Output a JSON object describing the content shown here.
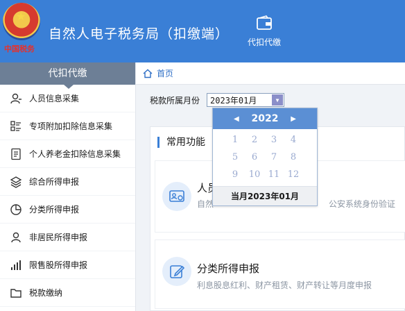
{
  "header": {
    "brand_seal": "中国税务",
    "title": "自然人电子税务局（扣缴端）",
    "nav_tab_label": "代扣代缴",
    "color": "#3a7fd6"
  },
  "sidebar": {
    "heading": "代扣代缴",
    "items": [
      {
        "label": "人员信息采集",
        "icon": "person-icon"
      },
      {
        "label": "专项附加扣除信息采集",
        "icon": "list-icon"
      },
      {
        "label": "个人养老金扣除信息采集",
        "icon": "document-icon"
      },
      {
        "label": "综合所得申报",
        "icon": "layers-icon"
      },
      {
        "label": "分类所得申报",
        "icon": "pie-icon"
      },
      {
        "label": "非居民所得申报",
        "icon": "person-outline-icon"
      },
      {
        "label": "限售股所得申报",
        "icon": "bar-chart-icon"
      },
      {
        "label": "税款缴纳",
        "icon": "folder-icon"
      }
    ]
  },
  "breadcrumb": {
    "home": "首页"
  },
  "tax_month": {
    "label": "税款所属月份",
    "value": "2023年01月"
  },
  "common_functions": {
    "title": "常用功能",
    "cards": [
      {
        "title": "人员",
        "desc_left": "自然",
        "desc_right": "公安系统身份验证",
        "icon": "id-card-icon"
      },
      {
        "title": "分类所得申报",
        "desc": "利息股息红利、财产租赁、财产转让等月度申报",
        "icon": "edit-icon"
      }
    ]
  },
  "month_picker": {
    "year": "2022",
    "months": [
      "1",
      "2",
      "3",
      "4",
      "5",
      "6",
      "7",
      "8",
      "9",
      "10",
      "11",
      "12"
    ],
    "current_button": "当月2023年01月",
    "header_color": "#5b8fd4"
  }
}
